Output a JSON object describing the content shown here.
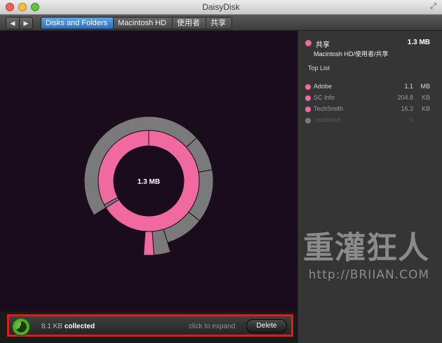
{
  "window": {
    "title": "DaisyDisk"
  },
  "toolbar": {
    "back_icon": "◀",
    "forward_icon": "▶",
    "breadcrumbs": [
      "Disks and Folders",
      "Macintosh HD",
      "使用者",
      "共享"
    ]
  },
  "chart": {
    "center_label": "1.3 MB"
  },
  "sidebar": {
    "selected": {
      "name": "共享",
      "size": "1.3 MB",
      "path": "Macintosh HD/使用者/共享",
      "color": "#f06aa0"
    },
    "top_list_label": "Top List",
    "items": [
      {
        "name": "Adobe",
        "value": "1.1",
        "unit": "MB",
        "color": "#f06aa0",
        "text_color": "#d8d8d8"
      },
      {
        "name": "SC Info",
        "value": "204.8",
        "unit": "KB",
        "color": "#f06aa0",
        "text_color": "#9a9a9a"
      },
      {
        "name": "TechSmith",
        "value": "16.3",
        "unit": "KB",
        "color": "#f06aa0",
        "text_color": "#9a9a9a"
      },
      {
        "name": ".localized",
        "value": "0",
        "unit": "",
        "color": "#7a7a7a",
        "text_color": "#5c5c5c"
      }
    ]
  },
  "watermark": {
    "text": "重灌狂人",
    "url": "http://BRIIAN.COM"
  },
  "bottom": {
    "collected_value": "8.1 KB",
    "collected_label": "collected",
    "expand_hint": "click to expand",
    "delete_label": "Delete"
  },
  "colors": {
    "accent": "#f06aa0",
    "folder_gray": "#7a7a7a",
    "highlight_border": "#e01b1b"
  }
}
